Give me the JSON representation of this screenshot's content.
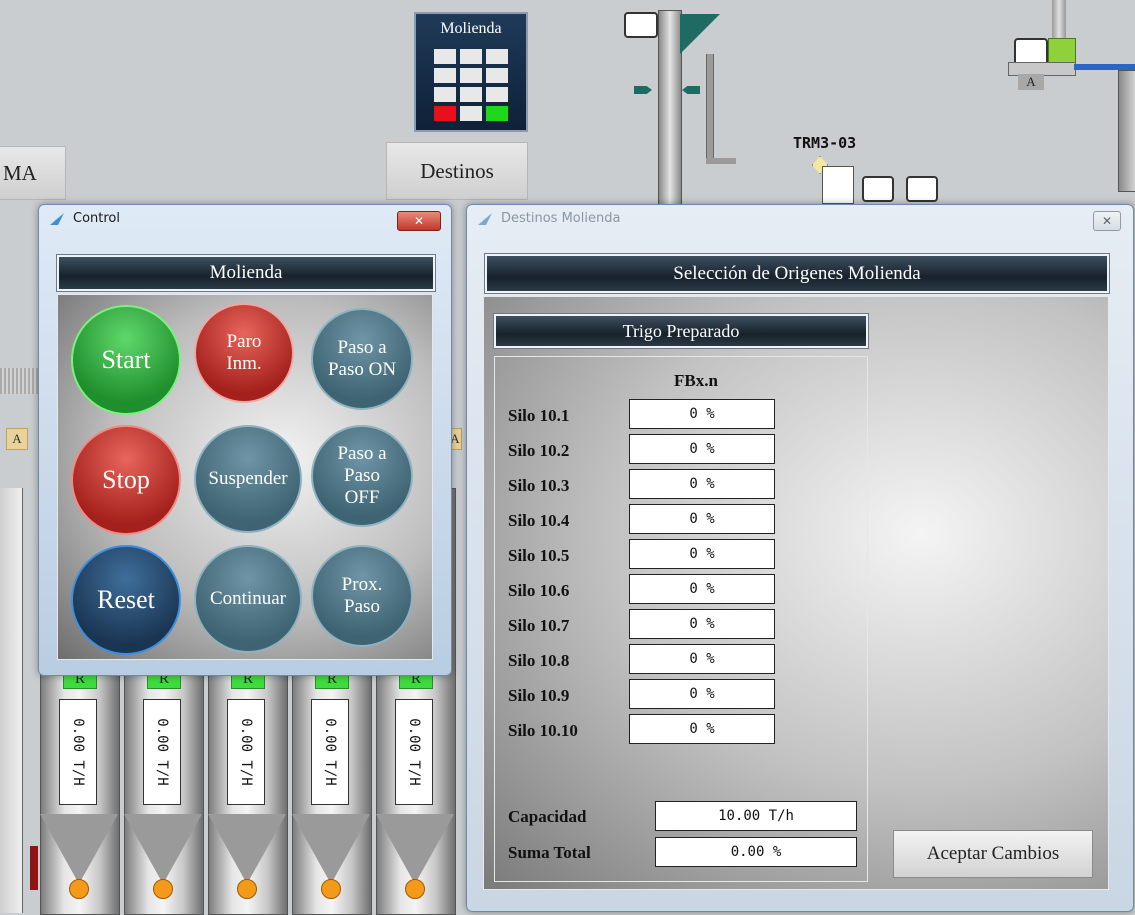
{
  "background": {
    "molienda_tile_label": "Molienda",
    "nav_buttons": {
      "left_partial": "MA",
      "destinos": "Destinos"
    },
    "equipment_tag": "TRM3-03",
    "a_label": "A",
    "hoppers": [
      {
        "tag": "R",
        "rate": "0.00 T/H"
      },
      {
        "tag": "R",
        "rate": "0.00 T/H"
      },
      {
        "tag": "R",
        "rate": "0.00 T/H"
      },
      {
        "tag": "R",
        "rate": "0.00 T/H"
      },
      {
        "tag": "R",
        "rate": "0.00 T/H"
      }
    ]
  },
  "control_window": {
    "title": "Control",
    "close_glyph": "✕",
    "banner": "Molienda",
    "buttons": {
      "start": "Start",
      "paro": "Paro Inm.",
      "paso_on": "Paso a Paso ON",
      "stop": "Stop",
      "suspender": "Suspender",
      "paso_off": "Paso a Paso OFF",
      "reset": "Reset",
      "continuar": "Continuar",
      "prox": "Prox. Paso"
    }
  },
  "destinos_window": {
    "title": "Destinos Molienda",
    "close_glyph": "✕",
    "banner": "Selección de Origenes Molienda",
    "section_title": "Trigo Preparado",
    "column_header": "FBx.n",
    "silos": [
      {
        "label": "Silo 10.1",
        "value": "0 %"
      },
      {
        "label": "Silo 10.2",
        "value": "0 %"
      },
      {
        "label": "Silo 10.3",
        "value": "0 %"
      },
      {
        "label": "Silo 10.4",
        "value": "0 %"
      },
      {
        "label": "Silo 10.5",
        "value": "0 %"
      },
      {
        "label": "Silo 10.6",
        "value": "0 %"
      },
      {
        "label": "Silo 10.7",
        "value": "0 %"
      },
      {
        "label": "Silo 10.8",
        "value": "0 %"
      },
      {
        "label": "Silo 10.9",
        "value": "0 %"
      },
      {
        "label": "Silo 10.10",
        "value": "0 %"
      }
    ],
    "capacidad_label": "Capacidad",
    "capacidad_value": "10.00 T/h",
    "suma_label": "Suma Total",
    "suma_value": "0.00 %",
    "accept_label": "Aceptar Cambios"
  }
}
